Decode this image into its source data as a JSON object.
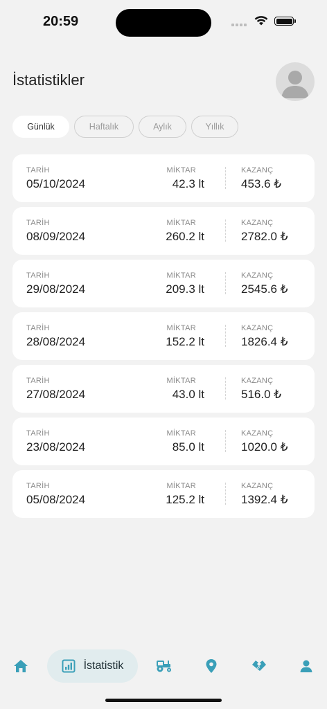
{
  "status_bar": {
    "time": "20:59"
  },
  "header": {
    "title": "İstatistikler"
  },
  "filters": [
    {
      "label": "Günlük",
      "active": true
    },
    {
      "label": "Haftalık",
      "active": false
    },
    {
      "label": "Aylık",
      "active": false
    },
    {
      "label": "Yıllık",
      "active": false
    }
  ],
  "list_labels": {
    "date": "TARİH",
    "quantity": "MİKTAR",
    "earnings": "KAZANÇ"
  },
  "records": [
    {
      "date": "05/10/2024",
      "quantity": "42.3 lt",
      "earnings": "453.6 ₺"
    },
    {
      "date": "08/09/2024",
      "quantity": "260.2 lt",
      "earnings": "2782.0 ₺"
    },
    {
      "date": "29/08/2024",
      "quantity": "209.3 lt",
      "earnings": "2545.6 ₺"
    },
    {
      "date": "28/08/2024",
      "quantity": "152.2 lt",
      "earnings": "1826.4 ₺"
    },
    {
      "date": "27/08/2024",
      "quantity": "43.0 lt",
      "earnings": "516.0 ₺"
    },
    {
      "date": "23/08/2024",
      "quantity": "85.0 lt",
      "earnings": "1020.0 ₺"
    },
    {
      "date": "05/08/2024",
      "quantity": "125.2 lt",
      "earnings": "1392.4 ₺"
    }
  ],
  "bottom_nav": {
    "active_label": "İstatistik",
    "items": [
      "home-icon",
      "stats-icon",
      "tractor-icon",
      "location-icon",
      "handshake-icon",
      "profile-icon"
    ],
    "accent_color": "#3a9fb8"
  }
}
